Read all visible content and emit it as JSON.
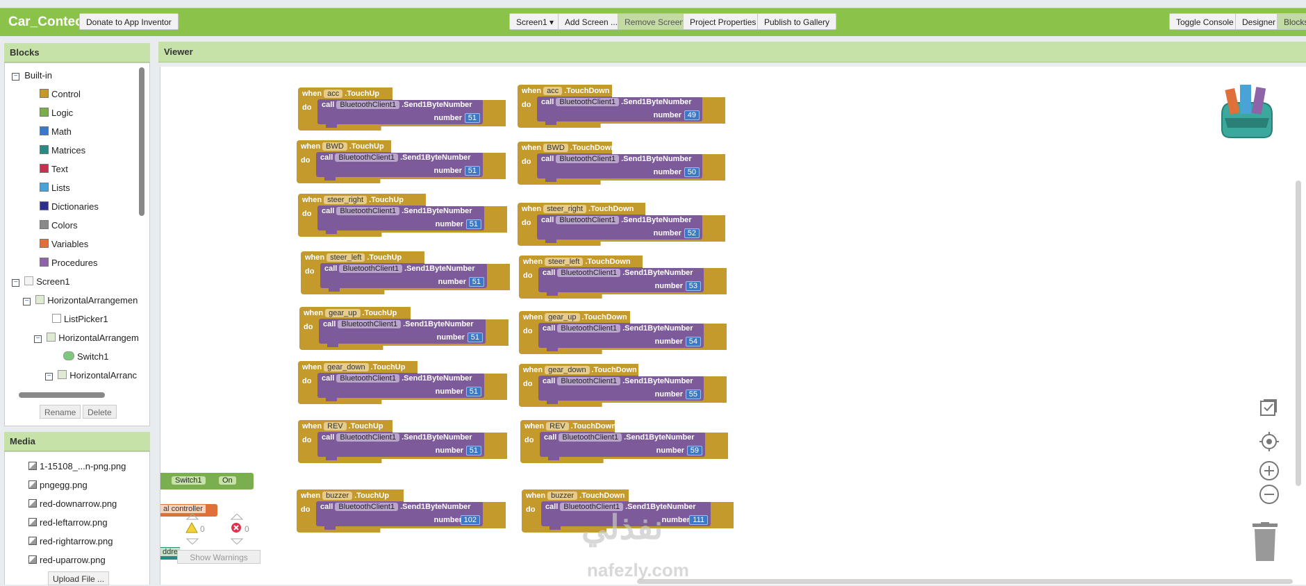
{
  "app_title": "Car_Conteol",
  "toolbar": {
    "donate": "Donate to App Inventor",
    "screen": "Screen1 ▾",
    "add_screen": "Add Screen ...",
    "remove_screen": "Remove Screen",
    "project_properties": "Project Properties",
    "publish": "Publish to Gallery",
    "toggle_console": "Toggle Console",
    "designer": "Designer",
    "blocks": "Blocks"
  },
  "blocks_panel": {
    "title": "Blocks",
    "builtin": "Built-in",
    "items": [
      {
        "label": "Control",
        "color": "#c49a2c"
      },
      {
        "label": "Logic",
        "color": "#7bae4e"
      },
      {
        "label": "Math",
        "color": "#3c78c8"
      },
      {
        "label": "Matrices",
        "color": "#2a8a82"
      },
      {
        "label": "Text",
        "color": "#c2334f"
      },
      {
        "label": "Lists",
        "color": "#4aa3d6"
      },
      {
        "label": "Dictionaries",
        "color": "#2b2d8f"
      },
      {
        "label": "Colors",
        "color": "#8a8a8a"
      },
      {
        "label": "Variables",
        "color": "#e0703a"
      },
      {
        "label": "Procedures",
        "color": "#8e63a8"
      }
    ],
    "screen": "Screen1",
    "components": [
      "HorizontalArrangemen",
      "ListPicker1",
      "HorizontalArrangem",
      "Switch1",
      "HorizontalArranc"
    ],
    "rename": "Rename",
    "delete": "Delete"
  },
  "media_panel": {
    "title": "Media",
    "files": [
      "1-15108_...n-png.png",
      "pngegg.png",
      "red-downarrow.png",
      "red-leftarrow.png",
      "red-rightarrow.png",
      "red-uparrow.png"
    ],
    "upload": "Upload File ..."
  },
  "viewer": {
    "title": "Viewer",
    "when": "when",
    "do": "do",
    "call": "call",
    "component": "BluetoothClient1",
    "method": ".Send1ByteNumber",
    "number_label": "number",
    "left_blocks": [
      {
        "comp": "acc",
        "event": ".TouchUp",
        "value": "51"
      },
      {
        "comp": "BWD",
        "event": ".TouchUp",
        "value": "51"
      },
      {
        "comp": "steer_right",
        "event": ".TouchUp",
        "value": "51"
      },
      {
        "comp": "steer_left",
        "event": ".TouchUp",
        "value": "51"
      },
      {
        "comp": "gear_up",
        "event": ".TouchUp",
        "value": "51"
      },
      {
        "comp": "gear_down",
        "event": ".TouchUp",
        "value": "51"
      },
      {
        "comp": "REV",
        "event": ".TouchUp",
        "value": "51"
      },
      {
        "comp": "buzzer",
        "event": ".TouchUp",
        "value": "102"
      }
    ],
    "right_blocks": [
      {
        "comp": "acc",
        "event": ".TouchDown",
        "value": "49"
      },
      {
        "comp": "BWD",
        "event": ".TouchDown",
        "value": "50"
      },
      {
        "comp": "steer_right",
        "event": ".TouchDown",
        "value": "52"
      },
      {
        "comp": "steer_left",
        "event": ".TouchDown",
        "value": "53"
      },
      {
        "comp": "gear_up",
        "event": ".TouchDown",
        "value": "54"
      },
      {
        "comp": "gear_down",
        "event": ".TouchDown",
        "value": "55"
      },
      {
        "comp": "REV",
        "event": ".TouchDown",
        "value": "59"
      },
      {
        "comp": "buzzer",
        "event": ".TouchDown",
        "value": "111"
      }
    ],
    "switch_block": {
      "comp": "Switch1",
      "state": "On"
    },
    "controller_block": "al controller",
    "address_block": "ddre",
    "warnings": "0",
    "errors": "0",
    "show_warnings": "Show Warnings",
    "watermark_ar": "نفذلي",
    "watermark_en": "nafezly.com"
  }
}
